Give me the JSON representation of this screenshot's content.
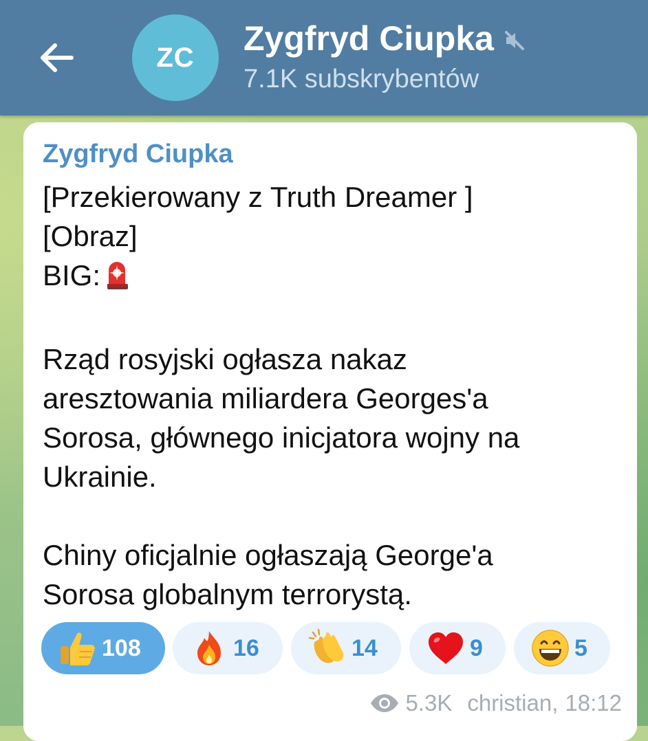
{
  "header": {
    "back_icon": "arrow-left-icon",
    "avatar_initials": "ZC",
    "avatar_color": "#5fbdd8",
    "title": "Zygfryd Ciupka",
    "mute_icon": "muted-speaker-icon",
    "subtitle": "7.1K subskrybentów",
    "background": "#517da2"
  },
  "message": {
    "sender": "Zygfryd Ciupka",
    "lines": [
      "[Przekierowany z Truth Dreamer ]",
      "[Obraz]",
      "BIG:",
      "",
      "Rząd rosyjski ogłasza nakaz",
      "aresztowania miliardera Georges'a",
      "Sorosa, głównego inicjatora wojny na",
      "Ukrainie.",
      "",
      "Chiny oficjalnie ogłaszają George'a",
      "Sorosa globalnym terrorystą."
    ],
    "inline_emoji": "siren-icon",
    "reactions": [
      {
        "emoji": "thumbs-up-icon",
        "count": "108",
        "active": true
      },
      {
        "emoji": "fire-icon",
        "count": "16",
        "active": false
      },
      {
        "emoji": "clapping-hands-icon",
        "count": "14",
        "active": false
      },
      {
        "emoji": "red-heart-icon",
        "count": "9",
        "active": false
      },
      {
        "emoji": "grinning-face-icon",
        "count": "5",
        "active": false
      }
    ],
    "views": "5.3K",
    "author": "christian,",
    "time": "18:12"
  }
}
